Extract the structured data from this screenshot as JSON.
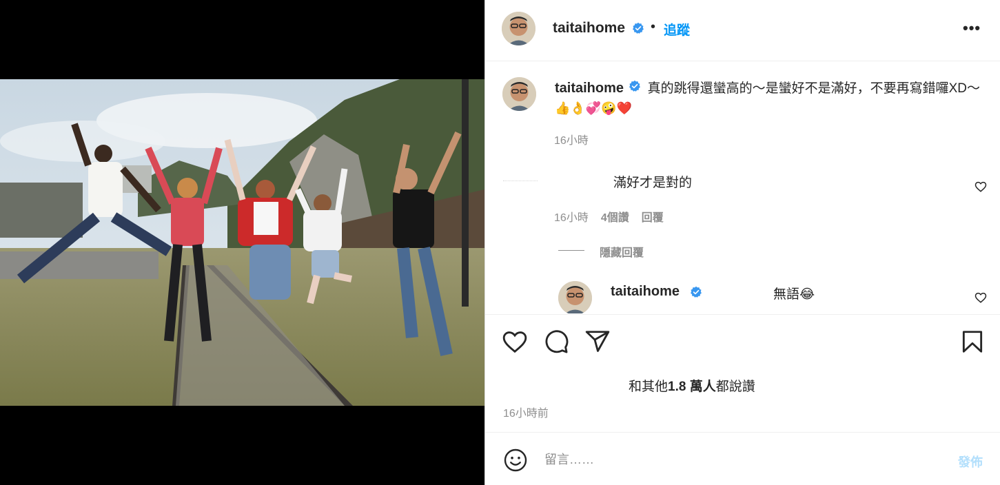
{
  "post": {
    "username": "taitaihome",
    "follow_label": "追蹤",
    "separator": "•",
    "more_label": "•••"
  },
  "caption": {
    "username": "taitaihome",
    "text": "真的跳得還蠻高的～是蠻好不是滿好，不要再寫錯囉XD～",
    "emojis": "👍👌💞🤪❤️",
    "time": "16小時"
  },
  "comment": {
    "text": "滿好才是對的",
    "time": "16小時",
    "likes": "4個讚",
    "reply_label": "回覆",
    "hide_replies_label": "隱藏回覆"
  },
  "reply": {
    "username": "taitaihome",
    "text": "無語😂"
  },
  "likes": {
    "prefix": "和其他",
    "count": "1.8 萬人",
    "suffix": "都說讚"
  },
  "timestamp": "16小時前",
  "composer": {
    "placeholder": "留言……",
    "post_label": "發佈"
  },
  "colors": {
    "accent": "#0095f6",
    "verified": "#3897f0",
    "muted": "#8e8e8e",
    "post_disabled": "#b2dffc"
  }
}
